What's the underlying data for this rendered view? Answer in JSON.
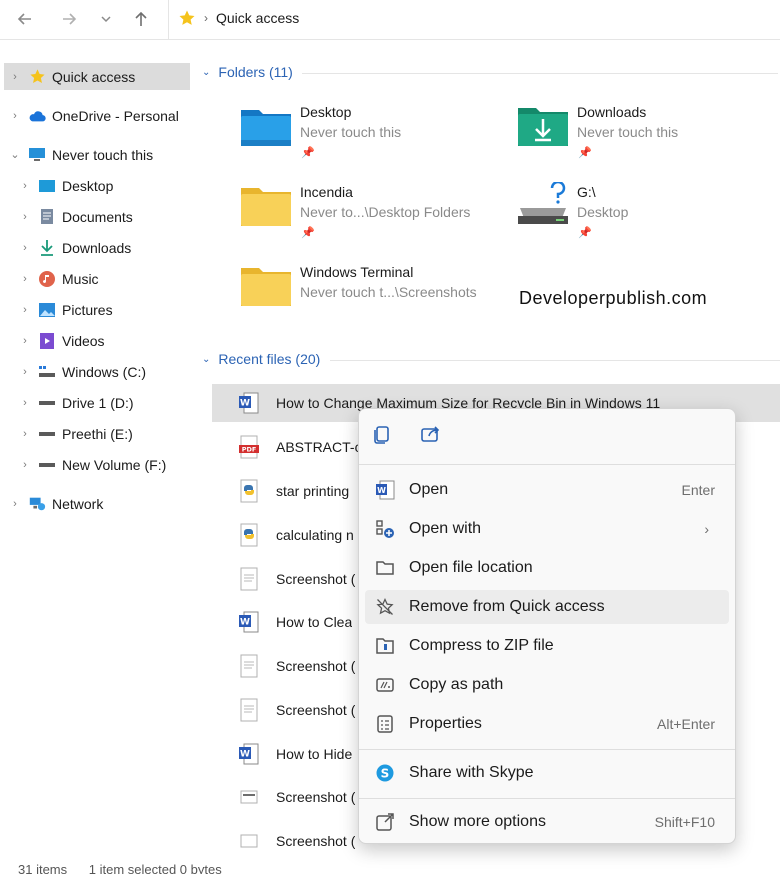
{
  "window": {
    "address": {
      "current": "Quick access"
    }
  },
  "sidebar": {
    "items": [
      {
        "label": "Quick access"
      },
      {
        "label": "OneDrive - Personal"
      },
      {
        "label": "Never touch this"
      },
      {
        "label": "Desktop"
      },
      {
        "label": "Documents"
      },
      {
        "label": "Downloads"
      },
      {
        "label": "Music"
      },
      {
        "label": "Pictures"
      },
      {
        "label": "Videos"
      },
      {
        "label": "Windows (C:)"
      },
      {
        "label": "Drive 1 (D:)"
      },
      {
        "label": "Preethi (E:)"
      },
      {
        "label": "New Volume (F:)"
      },
      {
        "label": "Network"
      }
    ]
  },
  "folders": {
    "header": "Folders (11)",
    "items": [
      {
        "name": "Desktop",
        "location": "Never touch this",
        "icon": "desktop-folder-icon"
      },
      {
        "name": "Downloads",
        "location": "Never touch this",
        "icon": "downloads-folder-icon"
      },
      {
        "name": "Incendia",
        "location": "Never to...\\Desktop Folders",
        "icon": "folder-icon"
      },
      {
        "name": "G:\\",
        "location": "Desktop",
        "icon": "drive-icon"
      },
      {
        "name": "Windows Terminal",
        "location": "Never touch t...\\Screenshots",
        "icon": "folder-icon"
      }
    ]
  },
  "watermark": "Developerpublish.com",
  "recent": {
    "header": "Recent files (20)",
    "files": [
      {
        "name": "How to Change Maximum Size for Recycle Bin in Windows 11",
        "type": "word"
      },
      {
        "name": "ABSTRACT-c",
        "type": "pdf"
      },
      {
        "name": "star printing",
        "type": "python"
      },
      {
        "name": "calculating n",
        "type": "python"
      },
      {
        "name": "Screenshot (",
        "type": "image"
      },
      {
        "name": "How to Clea",
        "type": "word"
      },
      {
        "name": "Screenshot (",
        "type": "image"
      },
      {
        "name": "Screenshot (",
        "type": "image"
      },
      {
        "name": "How to Hide",
        "type": "word"
      },
      {
        "name": "Screenshot (",
        "type": "image"
      },
      {
        "name": "Screenshot (",
        "type": "image"
      }
    ]
  },
  "context_menu": {
    "items": [
      {
        "label": "Open",
        "shortcut": "Enter",
        "icon": "word-icon"
      },
      {
        "label": "Open with",
        "shortcut": "",
        "icon": "open-with-icon"
      },
      {
        "label": "Open file location",
        "shortcut": "",
        "icon": "folder-outline-icon"
      },
      {
        "label": "Remove from Quick access",
        "shortcut": "",
        "icon": "unpin-icon"
      },
      {
        "label": "Compress to ZIP file",
        "shortcut": "",
        "icon": "zip-icon"
      },
      {
        "label": "Copy as path",
        "shortcut": "",
        "icon": "copy-path-icon"
      },
      {
        "label": "Properties",
        "shortcut": "Alt+Enter",
        "icon": "properties-icon"
      },
      {
        "label": "Share with Skype",
        "shortcut": "",
        "icon": "skype-icon"
      },
      {
        "label": "Show more options",
        "shortcut": "Shift+F10",
        "icon": "more-options-icon"
      }
    ]
  },
  "status": {
    "count": "31 items",
    "selection": "1 item selected  0 bytes"
  },
  "colors": {
    "accent": "#2b63b4",
    "selected_bg": "#e0e0e0",
    "folder_yellow": "#f6c744"
  }
}
